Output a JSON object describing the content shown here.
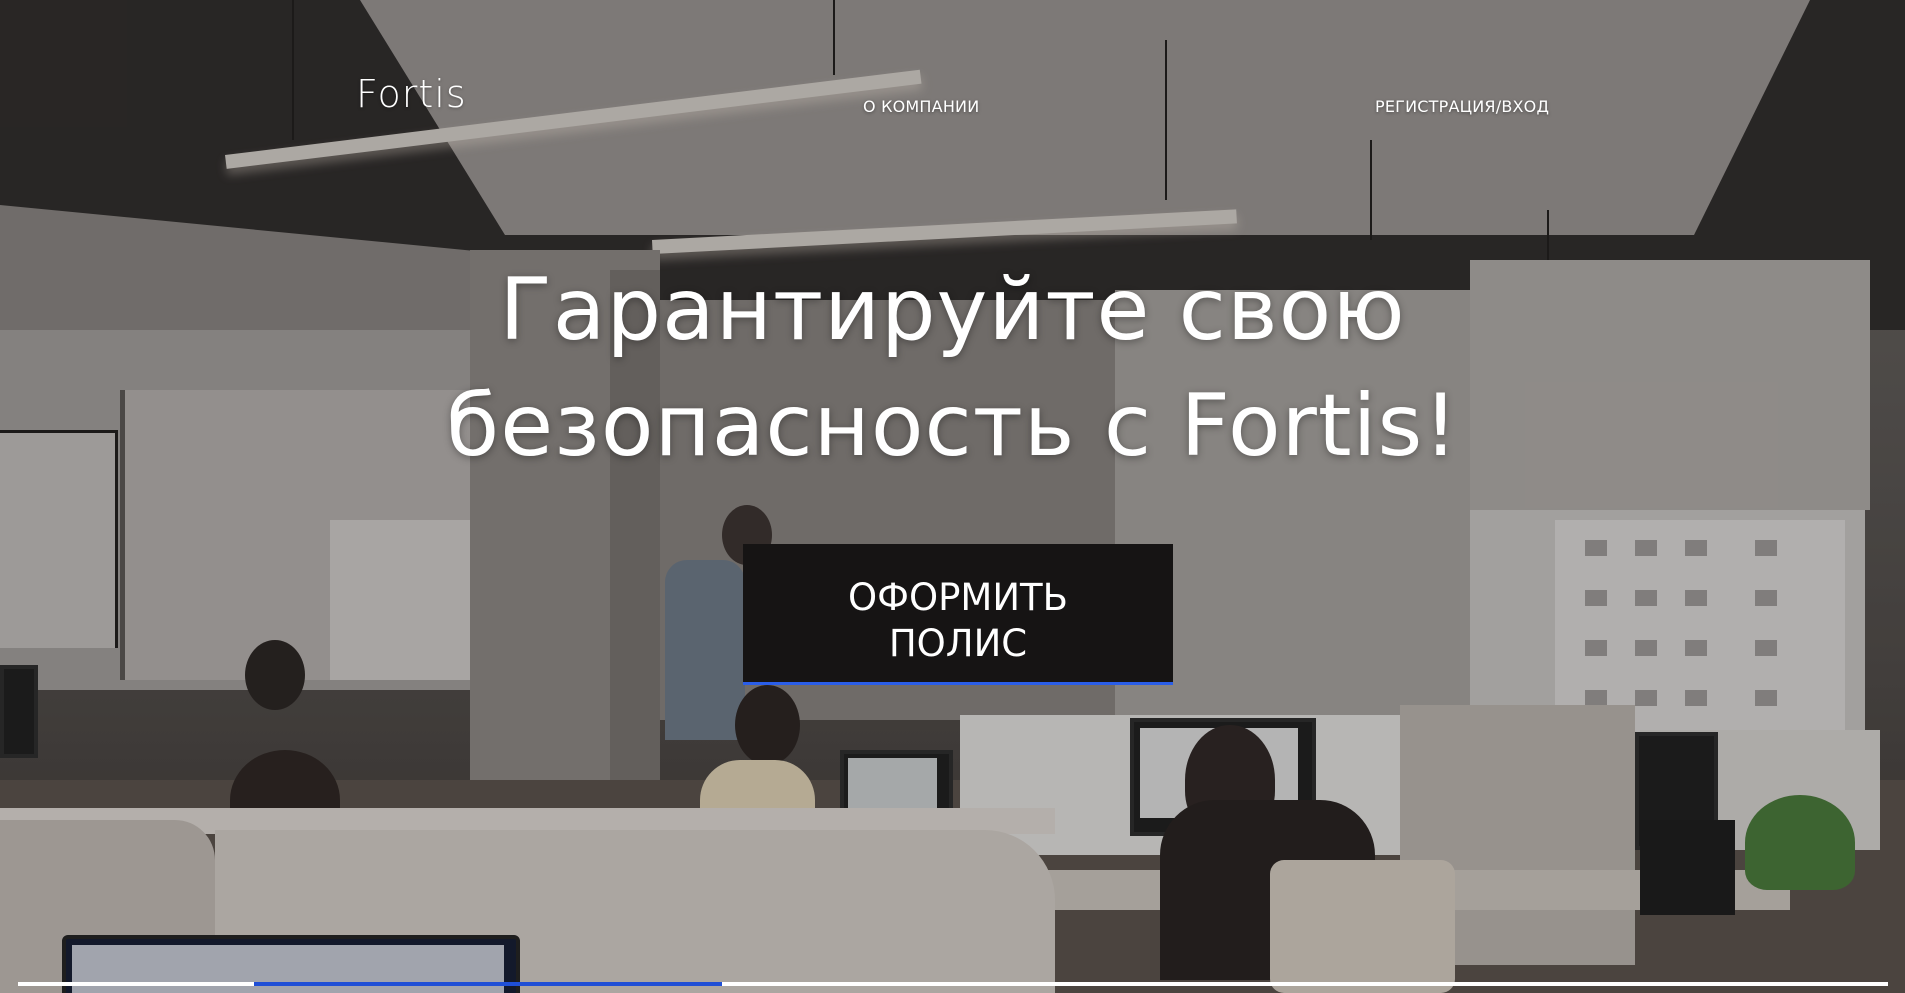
{
  "header": {
    "logo": "Fortis",
    "nav": [
      {
        "label": "О КОМПАНИИ"
      },
      {
        "label": "РЕГИСТРАЦИЯ/ВХОД"
      }
    ]
  },
  "hero": {
    "headline_line1": "Гарантируйте свою",
    "headline_line2": "безопасность с Fortis!",
    "cta_line1": "ОФОРМИТЬ",
    "cta_line2": "ПОЛИС",
    "background_image": "office-photo"
  },
  "slider": {
    "progress_fraction": 0.25
  },
  "colors": {
    "text": "#ffffff",
    "button_bg": "#161414",
    "accent": "#2a5ee8",
    "progress_track": "#ffffff",
    "progress_fill": "#1f4fd6"
  }
}
